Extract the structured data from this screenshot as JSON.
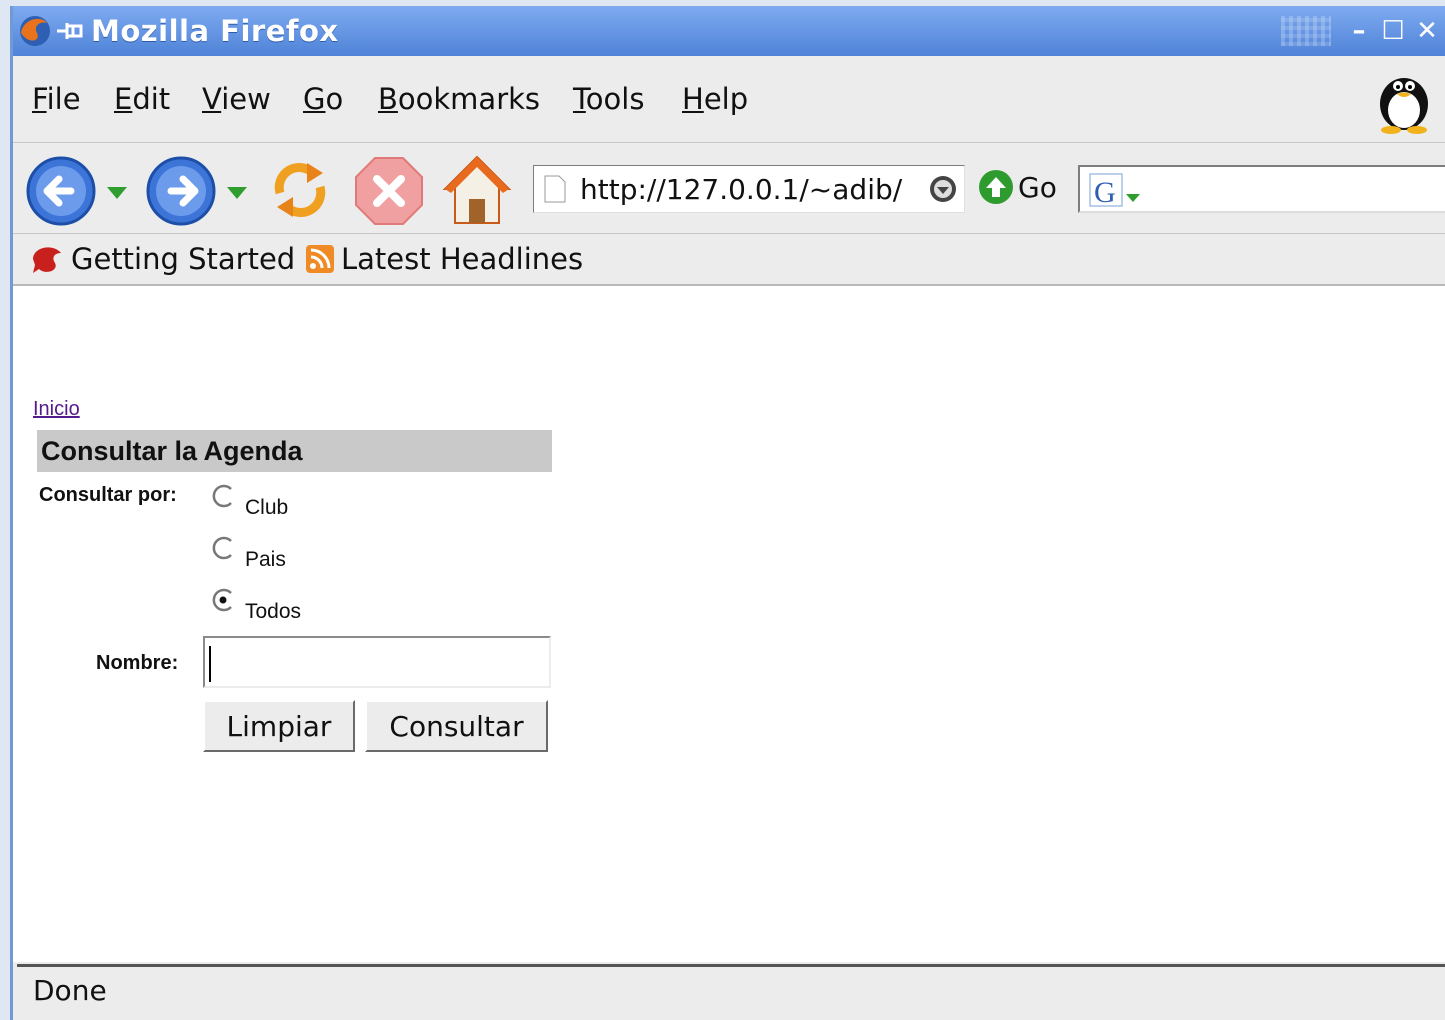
{
  "window": {
    "title": "Mozilla Firefox"
  },
  "menubar": {
    "items": [
      {
        "label": "File",
        "u": "F",
        "rest": "ile"
      },
      {
        "label": "Edit",
        "u": "E",
        "rest": "dit"
      },
      {
        "label": "View",
        "u": "V",
        "rest": "iew"
      },
      {
        "label": "Go",
        "u": "G",
        "rest": "o"
      },
      {
        "label": "Bookmarks",
        "u": "B",
        "rest": "ookmarks"
      },
      {
        "label": "Tools",
        "u": "T",
        "rest": "ools"
      },
      {
        "label": "Help",
        "u": "H",
        "rest": "elp"
      }
    ]
  },
  "navbar": {
    "url": "http://127.0.0.1/~adib/",
    "go_label": "Go"
  },
  "bookmarks": {
    "items": [
      "Getting Started",
      "Latest Headlines"
    ]
  },
  "page": {
    "inicio_link": "Inicio",
    "form_title": "Consultar la Agenda",
    "consultar_por_label": "Consultar por:",
    "radio_options": [
      "Club",
      "Pais",
      "Todos"
    ],
    "selected_option": "Todos",
    "nombre_label": "Nombre:",
    "nombre_value": "",
    "limpiar_label": "Limpiar",
    "consultar_label": "Consultar"
  },
  "status": {
    "text": "Done"
  },
  "colors": {
    "titlebar": "#4f83d8",
    "link": "#551a8b",
    "form_header": "#c9c9c9"
  }
}
